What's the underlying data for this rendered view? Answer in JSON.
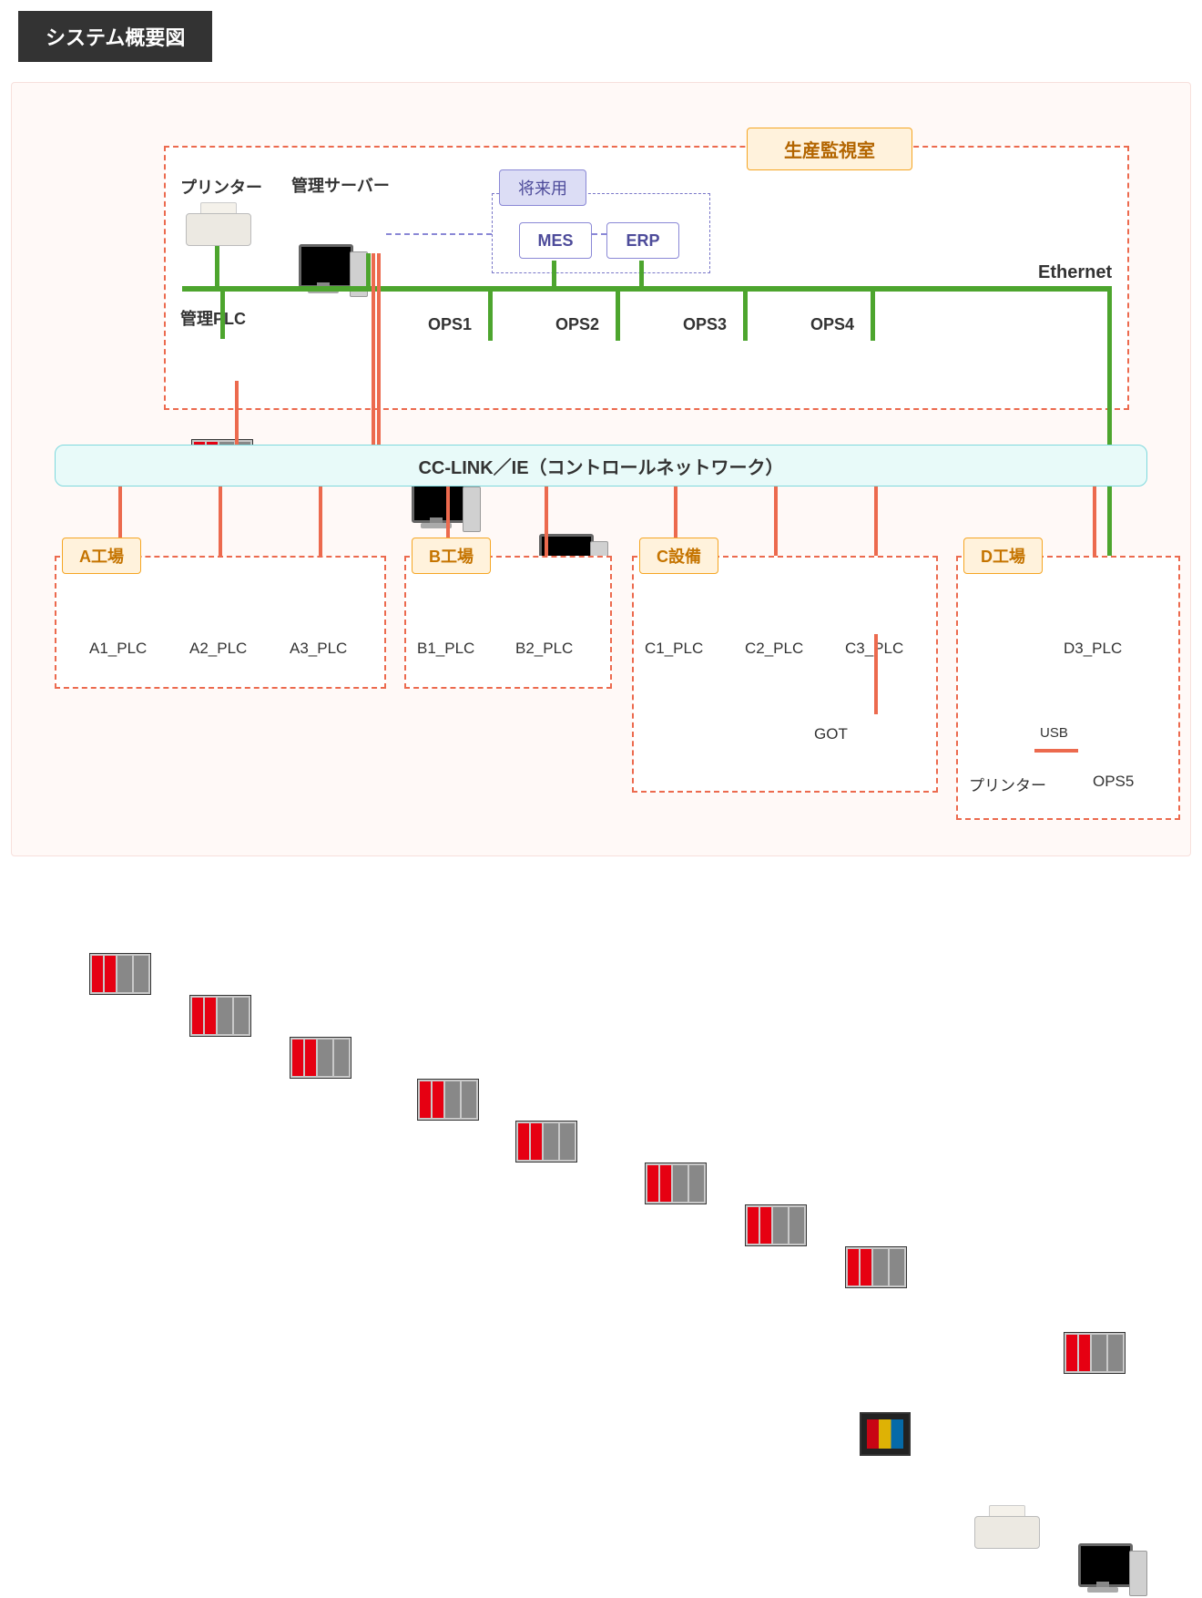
{
  "title": "システム概要図",
  "labels": {
    "ethernet": "Ethernet",
    "control_room": "生産監視室",
    "future": "将来用",
    "mes": "MES",
    "erp": "ERP",
    "printer": "プリンター",
    "mgmt_server": "管理サーバー",
    "mgmt_plc": "管理PLC",
    "ops1": "OPS1",
    "ops2": "OPS2",
    "ops3": "OPS3",
    "ops4": "OPS4",
    "ops5": "OPS5",
    "cclink": "CC-LINK／IE（コントロールネットワーク）",
    "fA": "A工場",
    "fB": "B工場",
    "fC": "C設備",
    "fD": "D工場",
    "a1": "A1_PLC",
    "a2": "A2_PLC",
    "a3": "A3_PLC",
    "b1": "B1_PLC",
    "b2": "B2_PLC",
    "c1": "C1_PLC",
    "c2": "C2_PLC",
    "c3": "C3_PLC",
    "d3": "D3_PLC",
    "got": "GOT",
    "usb": "USB",
    "printer2": "プリンター"
  }
}
